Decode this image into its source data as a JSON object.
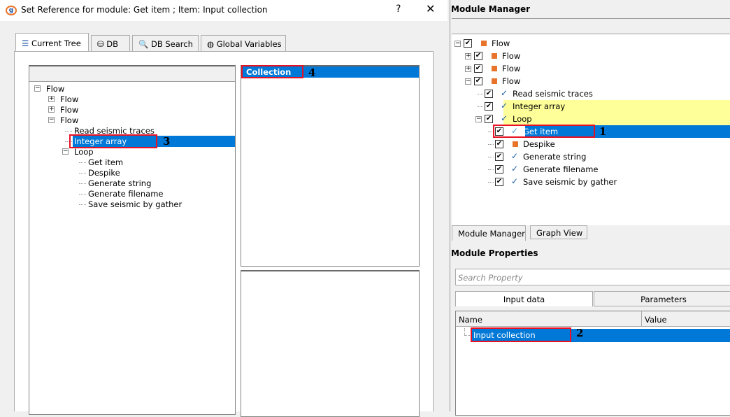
{
  "dialog": {
    "title": "Set Reference for module: Get item ; Item: Input collection",
    "help": "?",
    "close": "✕",
    "tabs": [
      {
        "label": "Current Tree",
        "icon": "tree-icon"
      },
      {
        "label": "DB",
        "icon": "database-icon"
      },
      {
        "label": "DB Search",
        "icon": "search-icon"
      },
      {
        "label": "Global Variables",
        "icon": "globe-icon"
      }
    ],
    "tree": [
      {
        "label": "Flow",
        "level": 0,
        "exp": "−"
      },
      {
        "label": "Flow",
        "level": 1,
        "exp": "+"
      },
      {
        "label": "Flow",
        "level": 1,
        "exp": "+"
      },
      {
        "label": "Flow",
        "level": 1,
        "exp": "−"
      },
      {
        "label": "Read seismic traces",
        "level": 2
      },
      {
        "label": "Integer array",
        "level": 2,
        "selected": true
      },
      {
        "label": "Loop",
        "level": 2,
        "exp": "−"
      },
      {
        "label": "Get item",
        "level": 3
      },
      {
        "label": "Despike",
        "level": 3
      },
      {
        "label": "Generate string",
        "level": 3
      },
      {
        "label": "Generate filename",
        "level": 3
      },
      {
        "label": "Save seismic by gather",
        "level": 3
      }
    ],
    "collection_list": [
      "Collection"
    ],
    "annotations": {
      "a3": "3",
      "a4": "4"
    }
  },
  "module_manager": {
    "title": "Module Manager",
    "tree": [
      {
        "label": "Flow",
        "level": 0,
        "exp": "−",
        "icon": "orange"
      },
      {
        "label": "Flow",
        "level": 1,
        "exp": "+",
        "icon": "orange"
      },
      {
        "label": "Flow",
        "level": 1,
        "exp": "+",
        "icon": "orange"
      },
      {
        "label": "Flow",
        "level": 1,
        "exp": "−",
        "icon": "orange"
      },
      {
        "label": "Read seismic traces",
        "level": 2,
        "icon": "check"
      },
      {
        "label": "Integer array",
        "level": 2,
        "icon": "check",
        "highlight": true
      },
      {
        "label": "Loop",
        "level": 2,
        "exp": "−",
        "icon": "check",
        "highlight": true
      },
      {
        "label": "Get item",
        "level": 3,
        "icon": "check",
        "selected": true
      },
      {
        "label": "Despike",
        "level": 3,
        "icon": "orange"
      },
      {
        "label": "Generate string",
        "level": 3,
        "icon": "check"
      },
      {
        "label": "Generate filename",
        "level": 3,
        "icon": "check"
      },
      {
        "label": "Save seismic by gather",
        "level": 3,
        "icon": "check"
      }
    ],
    "tabs": [
      "Module Manager",
      "Graph View"
    ],
    "annotation": "1"
  },
  "module_properties": {
    "title": "Module Properties",
    "search_placeholder": "Search Property",
    "subtabs": [
      "Input data",
      "Parameters"
    ],
    "columns": [
      "Name",
      "Value"
    ],
    "rows": [
      {
        "name": "Input collection",
        "value": ""
      }
    ],
    "annotation": "2"
  },
  "colors": {
    "selection": "#0078d7",
    "highlight": "#ffff99",
    "annotation_box": "#e81123",
    "status_orange": "#e8732a",
    "check_blue": "#1c5ea8"
  }
}
